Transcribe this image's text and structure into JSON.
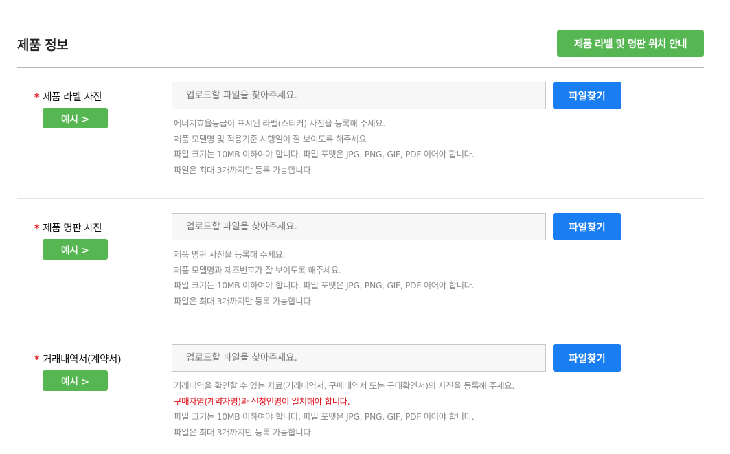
{
  "page": {
    "title": "제품 정보",
    "guide_button": "제품 라벨 및 명판 위치 안내"
  },
  "common": {
    "required_mark": "*",
    "example_button": "예시 >",
    "upload_placeholder": "업로드할 파일을 찾아주세요.",
    "find_button": "파일찾기"
  },
  "sections": [
    {
      "label": "제품 라벨 사진",
      "help": [
        "에너지효율등급이 표시된 라벨(스티커) 사진을 등록해 주세요.",
        "제품 모델명 및 적용기준 시행일이 잘 보이도록 해주세요",
        "파일 크기는 10MB 이하여야 합니다. 파일 포맷은 JPG, PNG, GIF, PDF 이어야 합니다.",
        "파일은 최대 3개까지만 등록 가능합니다."
      ]
    },
    {
      "label": "제품 명판 사진",
      "help": [
        "제품 명판 사진을 등록해 주세요.",
        "제품 모델명과 제조번호가 잘 보이도록 해주세요.",
        "파일 크기는 10MB 이하여야 합니다. 파일 포맷은 JPG, PNG, GIF, PDF 이어야 합니다.",
        "파일은 최대 3개까지만 등록 가능합니다."
      ]
    },
    {
      "label": "거래내역서(계약서)",
      "help": [
        "거래내역을 확인할 수 있는 자료(거래내역서, 구매내역서 또는 구매확인서)의 사진을 등록해 주세요.",
        "구매자명(계약자명)과 신청인명이 일치해야 합니다.",
        "파일 크기는 10MB 이하여야 합니다. 파일 포맷은 JPG, PNG, GIF, PDF 이어야 합니다.",
        "파일은 최대 3개까지만 등록 가능합니다."
      ],
      "warning_line_index": 1
    }
  ],
  "colors": {
    "green": "#55b652",
    "blue": "#1a7ef3",
    "required": "#e0262d",
    "warning": "#e0141e",
    "help_text": "#8a8a8a"
  }
}
